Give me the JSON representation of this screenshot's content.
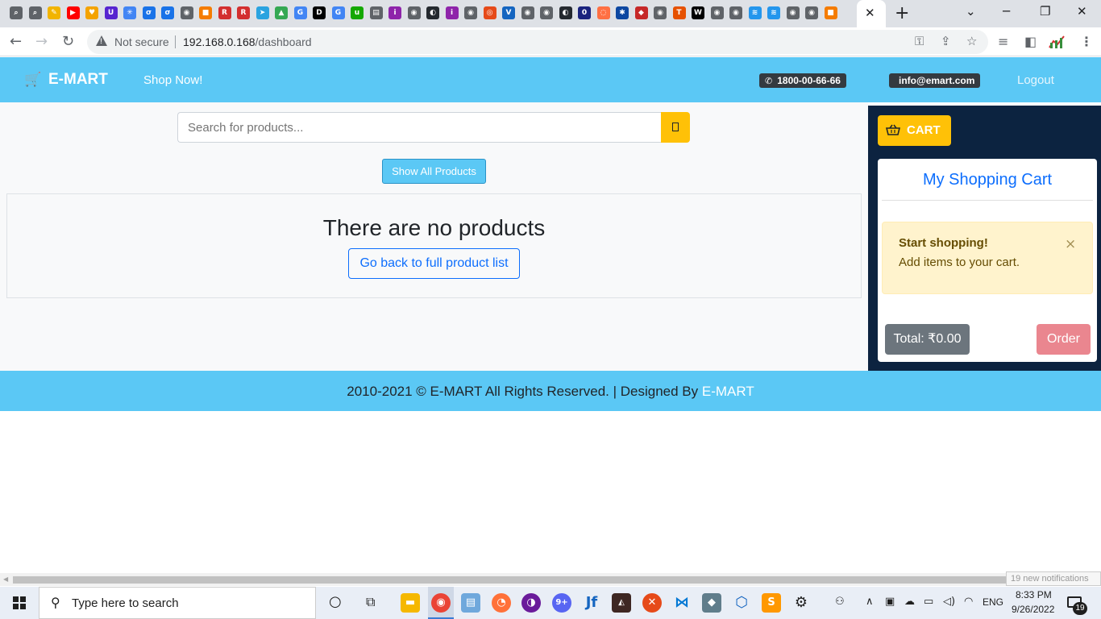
{
  "browser": {
    "url_host": "192.168.0.168",
    "url_path": "/dashboard",
    "security_label": "Not secure",
    "tab_favicons": [
      {
        "name": "tab-favicon-1",
        "color": "#5f6368",
        "glyph": "⌕"
      },
      {
        "name": "tab-favicon-2",
        "color": "#5f6368",
        "glyph": "⌕"
      },
      {
        "name": "tab-favicon-3",
        "color": "#f2b400",
        "glyph": "✎"
      },
      {
        "name": "tab-favicon-youtube",
        "color": "#ff0000",
        "glyph": "▶"
      },
      {
        "name": "tab-favicon-5",
        "color": "#f4a300",
        "glyph": "♥"
      },
      {
        "name": "tab-favicon-udemy",
        "color": "#5624d0",
        "glyph": "U"
      },
      {
        "name": "tab-favicon-7",
        "color": "#4285f4",
        "glyph": "✳"
      },
      {
        "name": "tab-favicon-8",
        "color": "#1a73e8",
        "glyph": "σ"
      },
      {
        "name": "tab-favicon-9",
        "color": "#1a73e8",
        "glyph": "σ"
      },
      {
        "name": "tab-favicon-10",
        "color": "#5f6368",
        "glyph": "◉"
      },
      {
        "name": "tab-favicon-11",
        "color": "#f57c00",
        "glyph": "■"
      },
      {
        "name": "tab-favicon-12",
        "color": "#d32f2f",
        "glyph": "R"
      },
      {
        "name": "tab-favicon-13",
        "color": "#d32f2f",
        "glyph": "R"
      },
      {
        "name": "tab-favicon-telegram",
        "color": "#2aa3e0",
        "glyph": "➤"
      },
      {
        "name": "tab-favicon-drive",
        "color": "#34a853",
        "glyph": "▲"
      },
      {
        "name": "tab-favicon-google",
        "color": "#4285f4",
        "glyph": "G"
      },
      {
        "name": "tab-favicon-dev",
        "color": "#000000",
        "glyph": "D"
      },
      {
        "name": "tab-favicon-google-2",
        "color": "#4285f4",
        "glyph": "G"
      },
      {
        "name": "tab-favicon-upwork",
        "color": "#14a800",
        "glyph": "u"
      },
      {
        "name": "tab-favicon-20",
        "color": "#5f6368",
        "glyph": "▤"
      },
      {
        "name": "tab-favicon-21",
        "color": "#8e24aa",
        "glyph": "i"
      },
      {
        "name": "tab-favicon-22",
        "color": "#5f6368",
        "glyph": "◉"
      },
      {
        "name": "tab-favicon-github",
        "color": "#24292f",
        "glyph": "◐"
      },
      {
        "name": "tab-favicon-24",
        "color": "#8e24aa",
        "glyph": "i"
      },
      {
        "name": "tab-favicon-25",
        "color": "#5f6368",
        "glyph": "◉"
      },
      {
        "name": "tab-favicon-26",
        "color": "#e64a19",
        "glyph": "◎"
      },
      {
        "name": "tab-favicon-27",
        "color": "#1565c0",
        "glyph": "V"
      },
      {
        "name": "tab-favicon-28",
        "color": "#5f6368",
        "glyph": "◉"
      },
      {
        "name": "tab-favicon-29",
        "color": "#5f6368",
        "glyph": "◉"
      },
      {
        "name": "tab-favicon-github-2",
        "color": "#24292f",
        "glyph": "◐"
      },
      {
        "name": "tab-favicon-31",
        "color": "#1a237e",
        "glyph": "0"
      },
      {
        "name": "tab-favicon-32",
        "color": "#ff7043",
        "glyph": "◌"
      },
      {
        "name": "tab-favicon-33",
        "color": "#0d47a1",
        "glyph": "✱"
      },
      {
        "name": "tab-favicon-34",
        "color": "#c62828",
        "glyph": "◆"
      },
      {
        "name": "tab-favicon-35",
        "color": "#5f6368",
        "glyph": "◉"
      },
      {
        "name": "tab-favicon-36",
        "color": "#e65100",
        "glyph": "T"
      },
      {
        "name": "tab-favicon-37",
        "color": "#000000",
        "glyph": "W"
      },
      {
        "name": "tab-favicon-38",
        "color": "#5f6368",
        "glyph": "◉"
      },
      {
        "name": "tab-favicon-39",
        "color": "#5f6368",
        "glyph": "◉"
      },
      {
        "name": "tab-favicon-docker",
        "color": "#2496ed",
        "glyph": "≋"
      },
      {
        "name": "tab-favicon-docker-2",
        "color": "#2496ed",
        "glyph": "≋"
      },
      {
        "name": "tab-favicon-42",
        "color": "#5f6368",
        "glyph": "◉"
      },
      {
        "name": "tab-favicon-43",
        "color": "#5f6368",
        "glyph": "◉"
      },
      {
        "name": "tab-favicon-44",
        "color": "#f57c00",
        "glyph": "■"
      }
    ]
  },
  "navbar": {
    "brand": "E-MART",
    "shop_now": "Shop Now!",
    "phone": "1800-00-66-66",
    "email": "info@emart.com",
    "logout": "Logout"
  },
  "main": {
    "search_placeholder": "Search for products...",
    "show_all_label": "Show All Products",
    "empty_title": "There are no products",
    "go_back_label": "Go back to full product list"
  },
  "cart": {
    "button_label": "CART",
    "title": "My Shopping Cart",
    "alert_strong": "Start shopping!",
    "alert_text": "Add items to your cart.",
    "alert_close": "×",
    "total_label": "Total: ₹0.00",
    "order_label": "Order"
  },
  "footer": {
    "text": "2010-2021 © E-MART All Rights Reserved. | Designed By ",
    "brand": "E-MART"
  },
  "notification_tooltip": "19 new notifications",
  "taskbar": {
    "search_placeholder": "Type here to search",
    "language": "ENG",
    "time": "8:33 PM",
    "date": "9/26/2022",
    "notification_count": "19"
  },
  "colors": {
    "navbar": "#5bc8f5",
    "cart_sidebar": "#0c2340",
    "accent_yellow": "#ffc107",
    "primary_blue": "#0d6efd"
  }
}
